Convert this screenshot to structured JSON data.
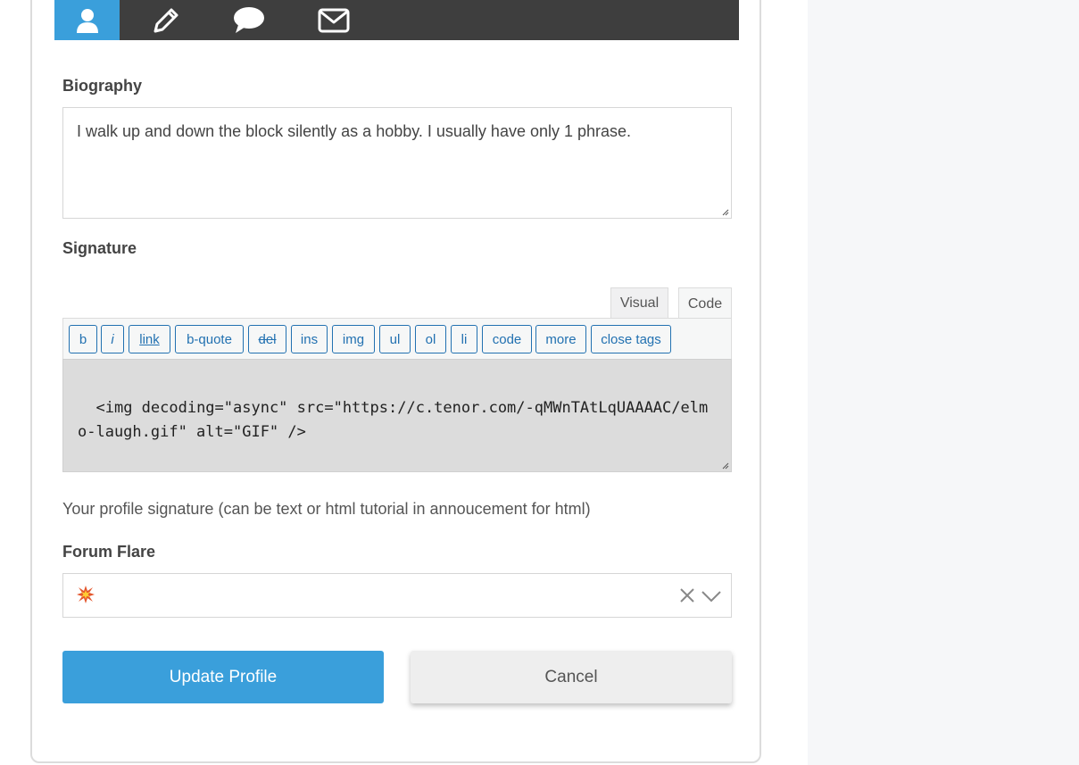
{
  "tabs": [
    {
      "icon": "user-icon",
      "active": true
    },
    {
      "icon": "pencil-icon",
      "active": false
    },
    {
      "icon": "speech-bubble-icon",
      "active": false
    },
    {
      "icon": "envelope-icon",
      "active": false
    }
  ],
  "biography": {
    "label": "Biography",
    "value": "I walk up and down the block silently as a hobby. I usually have only 1 phrase."
  },
  "signature": {
    "label": "Signature",
    "editor_tabs": {
      "visual": "Visual",
      "code": "Code"
    },
    "toolbar": [
      "b",
      "i",
      "link",
      "b-quote",
      "del",
      "ins",
      "img",
      "ul",
      "ol",
      "li",
      "code",
      "more",
      "close tags"
    ],
    "value": "<img decoding=\"async\" src=\"https://c.tenor.com/-qMWnTAtLqUAAAAC/elmo-laugh.gif\" alt=\"GIF\" />",
    "help": "Your profile signature (can be text or html tutorial in annoucement for html)"
  },
  "forum_flare": {
    "label": "Forum Flare",
    "selected_icon": "collision-icon"
  },
  "actions": {
    "update_label": "Update Profile",
    "cancel_label": "Cancel"
  },
  "colors": {
    "accent": "#3a9fdb",
    "tabbar": "#3e3e3e",
    "editor_link": "#2271b1"
  }
}
